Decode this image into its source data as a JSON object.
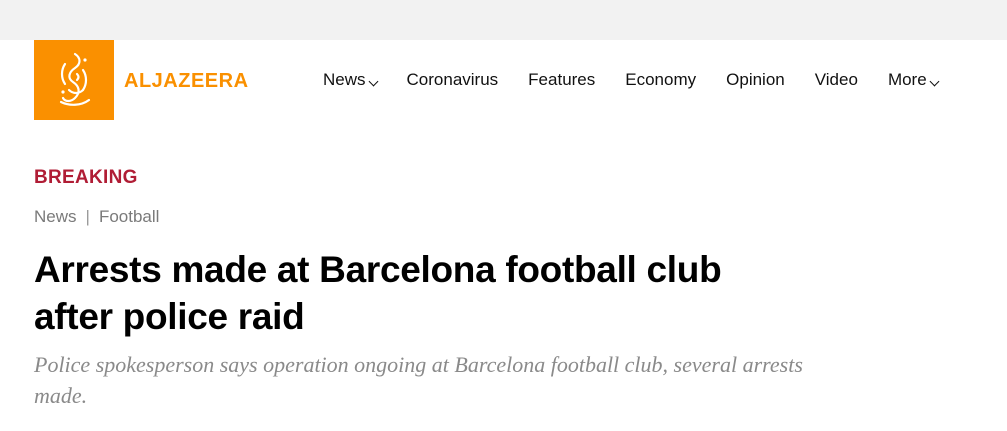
{
  "brand": {
    "name": "ALJAZEERA",
    "logo_color": "#fa9000"
  },
  "nav": {
    "items": [
      {
        "label": "News",
        "has_dropdown": true
      },
      {
        "label": "Coronavirus",
        "has_dropdown": false
      },
      {
        "label": "Features",
        "has_dropdown": false
      },
      {
        "label": "Economy",
        "has_dropdown": false
      },
      {
        "label": "Opinion",
        "has_dropdown": false
      },
      {
        "label": "Video",
        "has_dropdown": false
      },
      {
        "label": "More",
        "has_dropdown": true
      }
    ]
  },
  "article": {
    "badge": "BREAKING",
    "badge_color": "#b01d35",
    "breadcrumb": [
      "News",
      "Football"
    ],
    "breadcrumb_separator": "|",
    "headline": "Arrests made at Barcelona football club after police raid",
    "dek": "Police spokesperson says operation ongoing at Barcelona football club, several arrests made."
  },
  "icons": {
    "logo": "aljazeera-calligraphy-logo-icon",
    "dropdown": "chevron-down-icon"
  }
}
